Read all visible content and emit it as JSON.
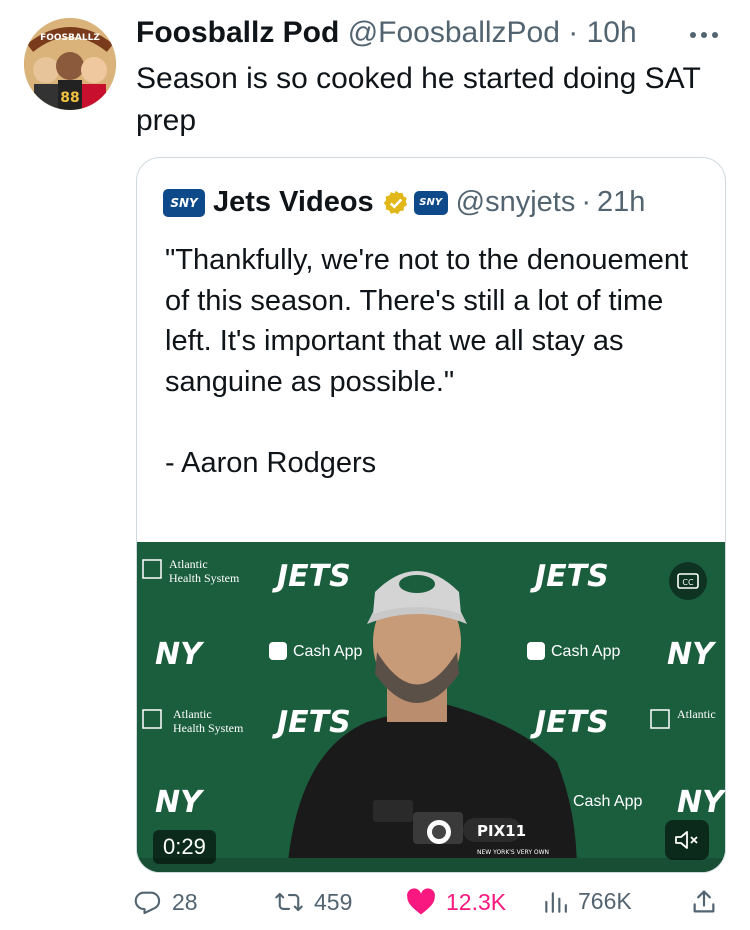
{
  "post": {
    "author_name": "Foosballz Pod",
    "author_handle": "@FoosballzPod",
    "separator": "·",
    "time": "10h",
    "text": "Season is so cooked he started doing SAT prep",
    "avatar_text": "FOOSBALLZ"
  },
  "quote": {
    "logo_text": "SNY",
    "name": "Jets Videos",
    "handle": "@snyjets",
    "separator": "·",
    "time": "21h",
    "text": "\"Thankfully, we're not to the denouement of this season. There's still a lot of time left. It's important that we all stay as sanguine as possible.\"\n\n- Aaron Rodgers"
  },
  "video": {
    "duration": "0:29",
    "backdrop_text": {
      "sponsor_1": "Atlantic",
      "sponsor_2": "Health System",
      "team": "JETS",
      "ny": "NY",
      "cashapp": "Cash App",
      "pix": "PIX11",
      "pix_tagline": "NEW YORK'S VERY OWN"
    }
  },
  "actions": {
    "replies": "28",
    "reposts": "459",
    "likes": "12.3K",
    "views": "766K"
  },
  "colors": {
    "text": "#0f1419",
    "muted": "#536471",
    "border": "#cfd9de",
    "like": "#f91880",
    "jets_green": "#1b5e3e",
    "verified_gold": "#e2b719"
  },
  "icons": [
    "more-icon",
    "sny-logo",
    "verified-badge-icon",
    "reply-icon",
    "repost-icon",
    "like-icon",
    "views-icon",
    "share-icon",
    "mute-icon",
    "cc-icon"
  ]
}
